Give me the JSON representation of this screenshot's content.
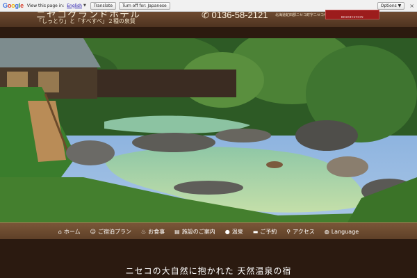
{
  "translate_bar": {
    "logo": "Google",
    "prompt": "View this page in:",
    "language": "English",
    "translate_label": "Translate",
    "turn_off_label": "Turn off for: Japanese",
    "options_label": "Options ▼",
    "close": "×"
  },
  "header": {
    "title": "ニセコグランドホテル",
    "tagline": "「しっとり」と「すべすべ」２種の泉質",
    "phone": "✆ 0136-58-2121",
    "address": "北海道虻田郡ニセコ町字ニセコ412番地",
    "reserve_label": "RESERVATION"
  },
  "nav": {
    "items": [
      {
        "icon": "home-icon",
        "glyph": "⌂",
        "label": "ホーム"
      },
      {
        "icon": "users-icon",
        "glyph": "☺",
        "label": "ご宿泊プラン"
      },
      {
        "icon": "food-icon",
        "glyph": "♨",
        "label": "お食事"
      },
      {
        "icon": "building-icon",
        "glyph": "▤",
        "label": "施設のご案内"
      },
      {
        "icon": "drop-icon",
        "glyph": "●",
        "label": "温泉"
      },
      {
        "icon": "bed-icon",
        "glyph": "▬",
        "label": "ご予約"
      },
      {
        "icon": "map-marker-icon",
        "glyph": "⚲",
        "label": "アクセス"
      },
      {
        "icon": "globe-icon",
        "glyph": "◍",
        "label": "Language"
      }
    ]
  },
  "content": {
    "title": "ニセコの大自然に抱かれた 天然温泉の宿"
  },
  "colors": {
    "header": "#5d3f27",
    "reserve": "#9c1c1c",
    "background": "#2b1a10"
  }
}
